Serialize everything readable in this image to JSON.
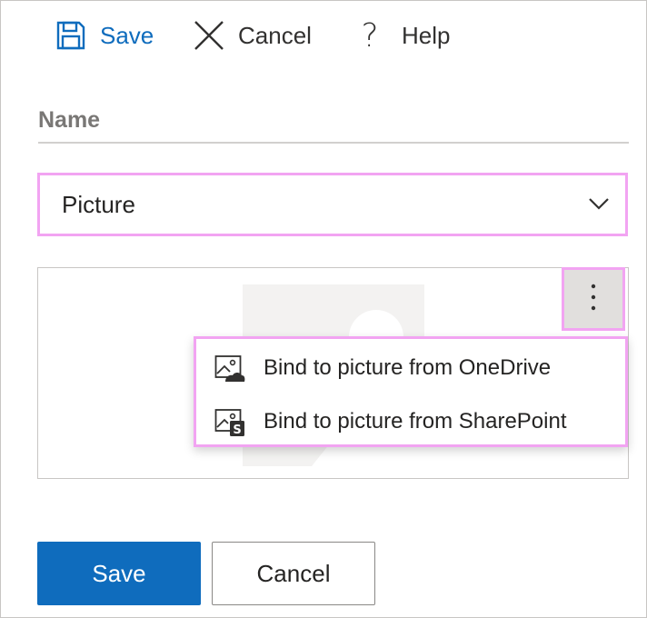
{
  "toolbar": {
    "save_label": "Save",
    "cancel_label": "Cancel",
    "help_label": "Help"
  },
  "form": {
    "name_placeholder": "Name",
    "type_value": "Picture"
  },
  "picture_menu": {
    "more_icon": "more-vertical-icon",
    "items": [
      {
        "label": "Bind to picture from OneDrive",
        "icon": "onedrive-picture-icon"
      },
      {
        "label": "Bind to picture from SharePoint",
        "icon": "sharepoint-picture-icon"
      }
    ]
  },
  "footer": {
    "save_label": "Save",
    "cancel_label": "Cancel"
  },
  "colors": {
    "accent": "#0f6cbd",
    "highlight": "#f2a4f2"
  }
}
